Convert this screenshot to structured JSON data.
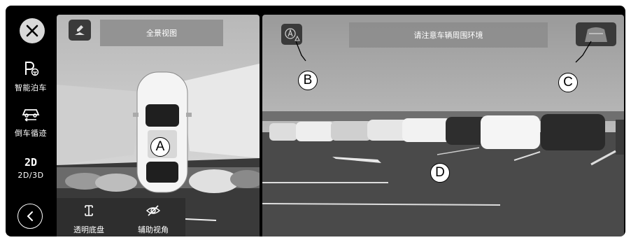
{
  "sidebar": {
    "close_icon": "close-icon",
    "items": [
      {
        "label": "智能泊车",
        "icon": "parking-icon"
      },
      {
        "label": "倒车循迹",
        "icon": "reverse-trace-icon"
      },
      {
        "label": "2D/3D",
        "main": "2D"
      }
    ],
    "back_icon": "chevron-left-icon"
  },
  "left_view": {
    "title": "全景视图",
    "bottom_menu": [
      {
        "label": "透明底盘",
        "icon": "transparent-chassis-icon"
      },
      {
        "label": "辅助视角",
        "icon": "eye-off-icon"
      }
    ],
    "callout": "A"
  },
  "right_view": {
    "title": "请注意车辆周围环境",
    "callouts": [
      "B",
      "C",
      "D"
    ]
  },
  "colors": {
    "background": "#000000",
    "button": "#d8d8d8",
    "title_bar": "#8c8c8c"
  }
}
